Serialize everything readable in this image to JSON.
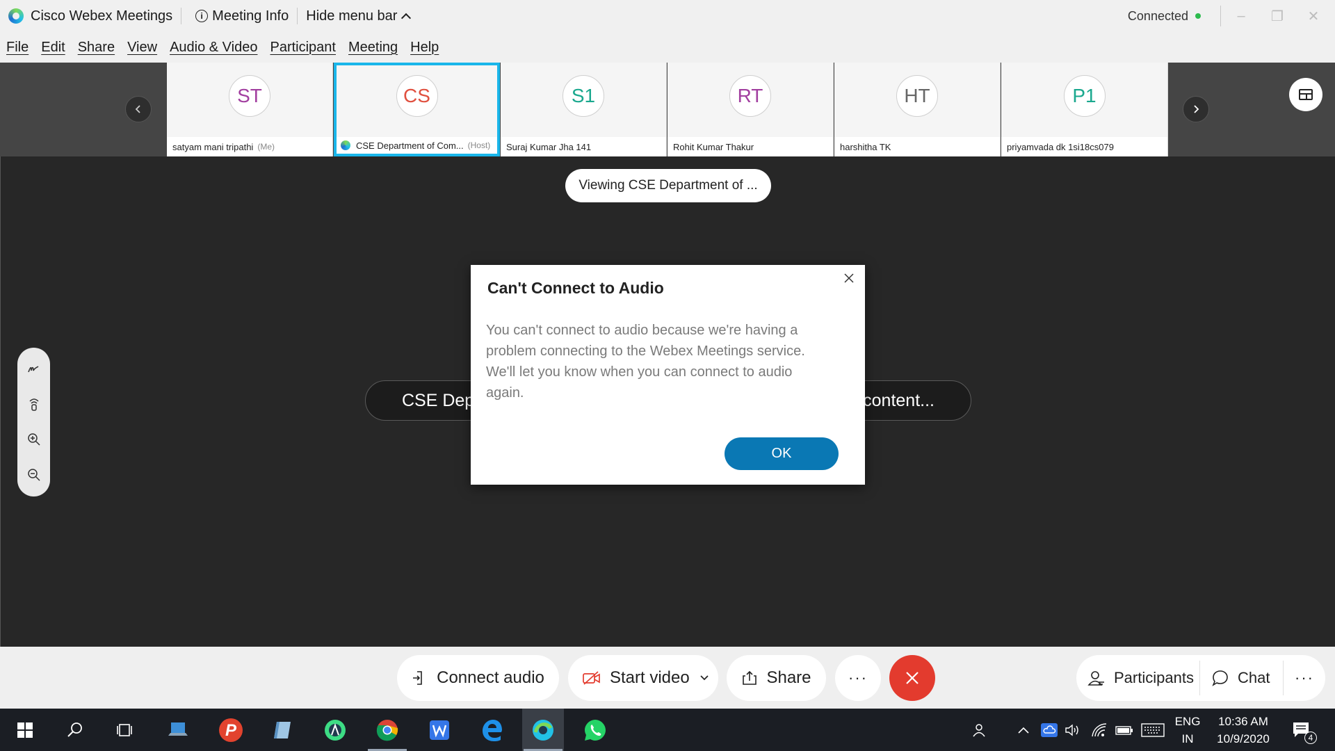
{
  "window": {
    "app_title": "Cisco Webex Meetings",
    "meeting_info_label": "Meeting Info",
    "hide_menu_label": "Hide menu bar",
    "status": "Connected",
    "status_color": "#2dbb4e"
  },
  "menu": [
    "File",
    "Edit",
    "Share",
    "View",
    "Audio & Video",
    "Participant",
    "Meeting",
    "Help"
  ],
  "participants": [
    {
      "initials": "ST",
      "name": "satyam mani tripathi",
      "tag": "(Me)",
      "color": "#a23fa0"
    },
    {
      "initials": "CS",
      "name": "CSE Department of Com...",
      "tag": "(Host)",
      "color": "#e0503f"
    },
    {
      "initials": "S1",
      "name": "Suraj Kumar Jha 141",
      "tag": "",
      "color": "#1aa88e"
    },
    {
      "initials": "RT",
      "name": "Rohit Kumar Thakur",
      "tag": "",
      "color": "#a23fa0"
    },
    {
      "initials": "HT",
      "name": "harshitha TK",
      "tag": "",
      "color": "#666666"
    },
    {
      "initials": "P1",
      "name": "priyamvada dk 1si18cs079",
      "tag": "",
      "color": "#1aa88e"
    }
  ],
  "stage": {
    "viewing_label": "Viewing CSE Department of ...",
    "content_left": "CSE Depa",
    "content_right": "content..."
  },
  "dialog": {
    "title": "Can't Connect to Audio",
    "message": "You can't connect to audio because we're having a problem connecting to the Webex Meetings service. We'll let you know when you can connect to audio again.",
    "ok_label": "OK"
  },
  "controls": {
    "connect_audio": "Connect audio",
    "start_video": "Start video",
    "share": "Share",
    "more": "···",
    "participants": "Participants",
    "chat": "Chat"
  },
  "taskbar": {
    "lang_line1": "ENG",
    "lang_line2": "IN",
    "time": "10:36 AM",
    "date": "10/9/2020",
    "notification_count": "4"
  }
}
